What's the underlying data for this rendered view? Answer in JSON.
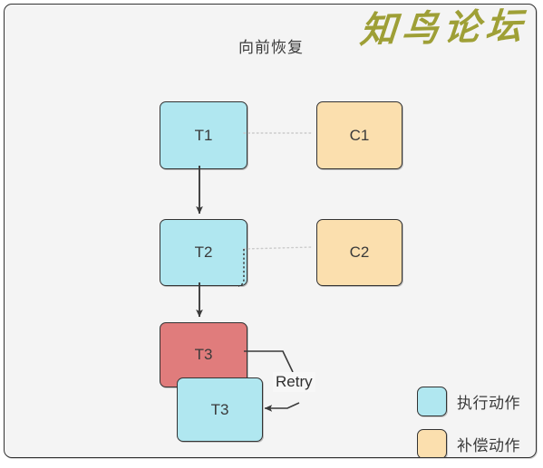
{
  "diagram": {
    "title": "向前恢复",
    "watermark": "知鸟论坛",
    "background_color": "#f4f4f4",
    "border_color": "#333333"
  },
  "colors": {
    "exec_fill": "#b0e7f0",
    "comp_fill": "#fbdfae",
    "fail_fill": "#e07c7c",
    "stroke": "#333333",
    "watermark": "#9a9b2c",
    "dotted_link": "#cccccc"
  },
  "nodes": {
    "t1": {
      "label": "T1",
      "kind": "exec"
    },
    "c1": {
      "label": "C1",
      "kind": "comp"
    },
    "t2": {
      "label": "T2",
      "kind": "exec"
    },
    "c2": {
      "label": "C2",
      "kind": "comp"
    },
    "t3_failed": {
      "label": "T3",
      "kind": "fail"
    },
    "t3_retry": {
      "label": "T3",
      "kind": "exec"
    }
  },
  "edges": {
    "t1_to_t2": {
      "type": "arrow",
      "from": "t1",
      "to": "t2",
      "label": ""
    },
    "t2_to_t3": {
      "type": "arrow",
      "from": "t2",
      "to": "t3_failed",
      "label": ""
    },
    "t1_to_c1": {
      "type": "dotted",
      "from": "t1",
      "to": "c1",
      "label": ""
    },
    "t2_to_c2": {
      "type": "dotted",
      "from": "t2",
      "to": "c2",
      "label": ""
    },
    "retry": {
      "type": "arrow",
      "from": "t3_failed",
      "to": "t3_retry",
      "label": "Retry"
    }
  },
  "legend": {
    "items": [
      {
        "label": "执行动作",
        "kind": "exec"
      },
      {
        "label": "补偿动作",
        "kind": "comp"
      }
    ]
  }
}
